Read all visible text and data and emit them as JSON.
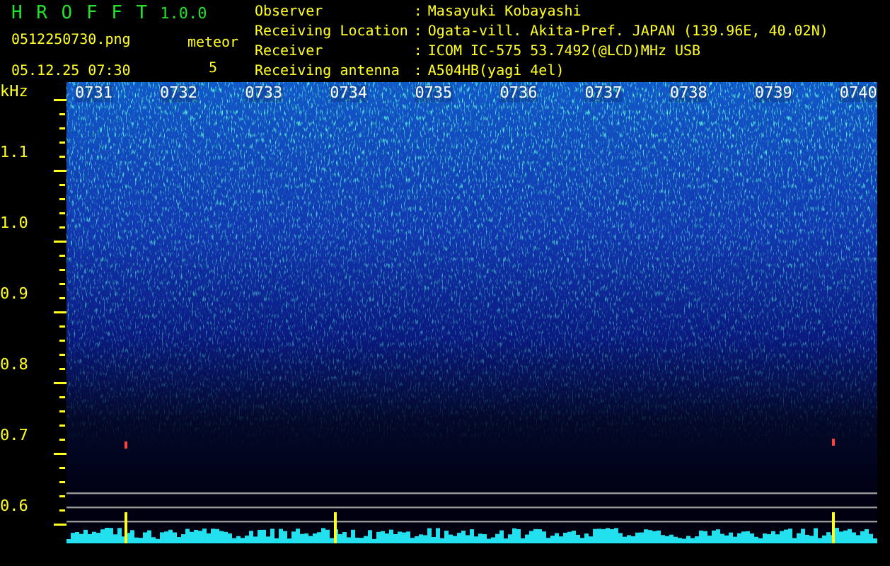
{
  "app": {
    "title": "H R O F F T",
    "version": "1.0.0",
    "file": "0512250730.png",
    "datetime": "05.12.25 07:30"
  },
  "meteor": {
    "label": "meteor",
    "count": "5"
  },
  "info": [
    {
      "label": "Observer",
      "separator": ":",
      "value": "Masayuki Kobayashi"
    },
    {
      "label": "Receiving Location",
      "separator": ":",
      "value": "Ogata-vill. Akita-Pref. JAPAN (139.96E, 40.02N)"
    },
    {
      "label": "Receiver",
      "separator": ":",
      "value": "ICOM IC-575 53.7492(@LCD)MHz USB"
    },
    {
      "label": "Receiving antenna",
      "separator": ":",
      "value": "A504HB(yagi 4el)"
    }
  ],
  "axis": {
    "unit": "kHz",
    "labels": [
      "1.1",
      "1.0",
      "0.9",
      "0.8",
      "0.7",
      "0.6"
    ]
  },
  "time_labels": [
    "0731",
    "0732",
    "0733",
    "0734",
    "0735",
    "0736",
    "0737",
    "0738",
    "0739",
    "0740"
  ]
}
